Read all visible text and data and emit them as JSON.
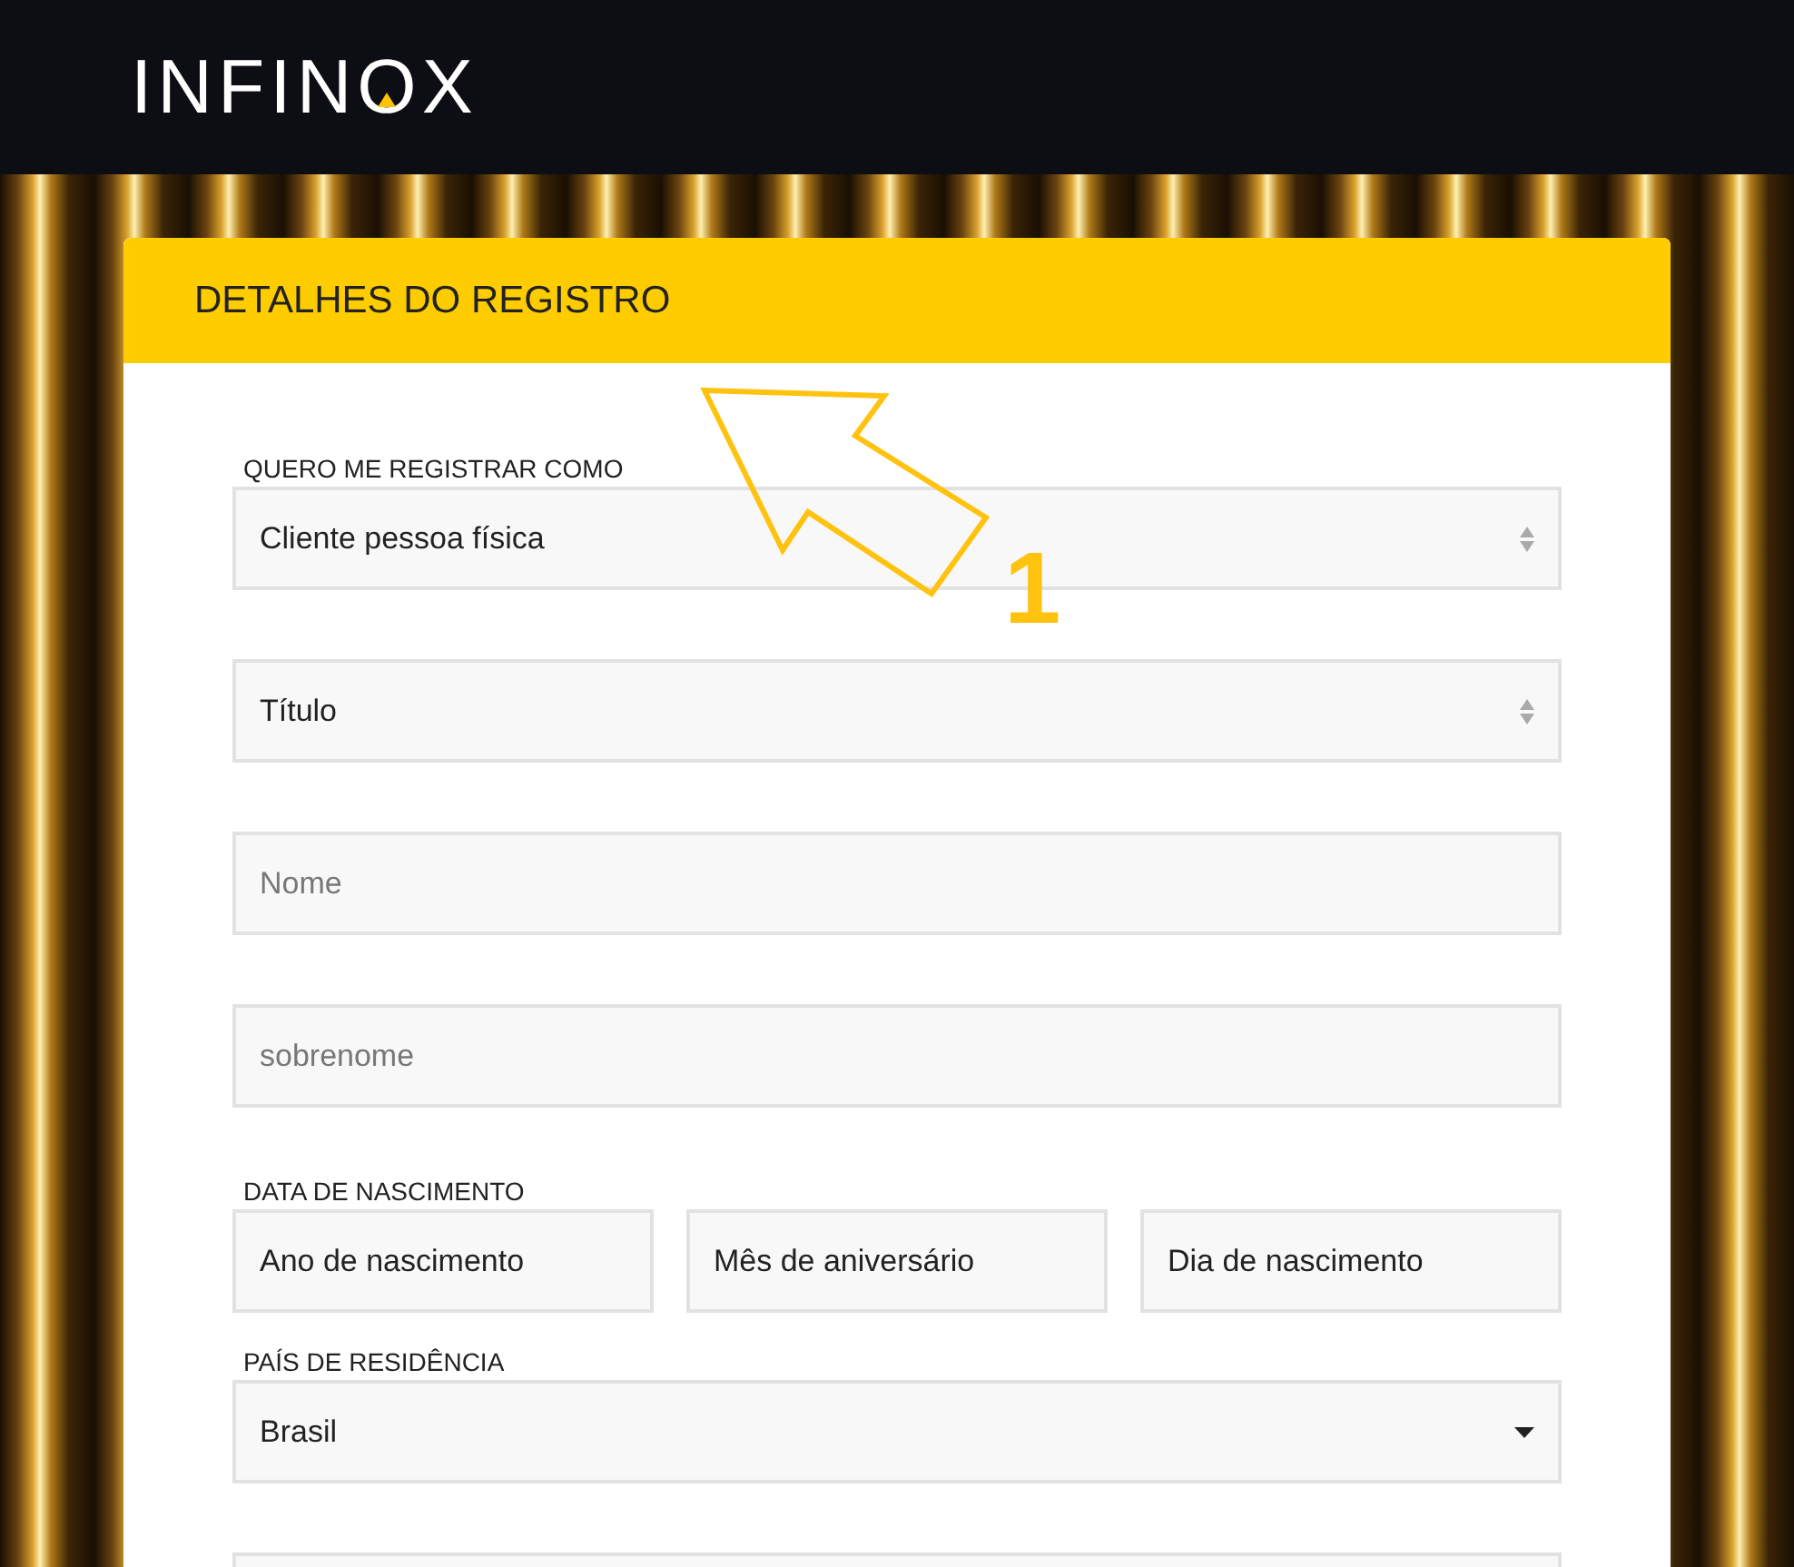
{
  "header": {
    "logo": "INFINOX"
  },
  "card": {
    "title": "DETALHES DO REGISTRO"
  },
  "groups": [
    {
      "label": "QUERO ME REGISTRAR COMO",
      "fields": [
        {
          "kind": "select",
          "value": "Cliente pessoa física"
        }
      ]
    },
    {
      "fields": [
        {
          "kind": "select",
          "value": "Título"
        }
      ]
    },
    {
      "fields": [
        {
          "kind": "input",
          "placeholder": "Nome"
        }
      ]
    },
    {
      "fields": [
        {
          "kind": "input",
          "placeholder": "sobrenome"
        }
      ]
    },
    {
      "label": "DATA DE NASCIMENTO",
      "fields": [
        {
          "kind": "plain",
          "value": "Ano de nascimento"
        },
        {
          "kind": "plain",
          "value": "Mês de aniversário"
        },
        {
          "kind": "plain",
          "value": "Dia de nascimento"
        }
      ]
    },
    {
      "label": "PAÍS DE RESIDÊNCIA",
      "fields": [
        {
          "kind": "dropdown",
          "value": "Brasil"
        }
      ]
    },
    {
      "fields": [
        {
          "kind": "plain"
        }
      ]
    }
  ],
  "annotation": {
    "number": "1"
  }
}
